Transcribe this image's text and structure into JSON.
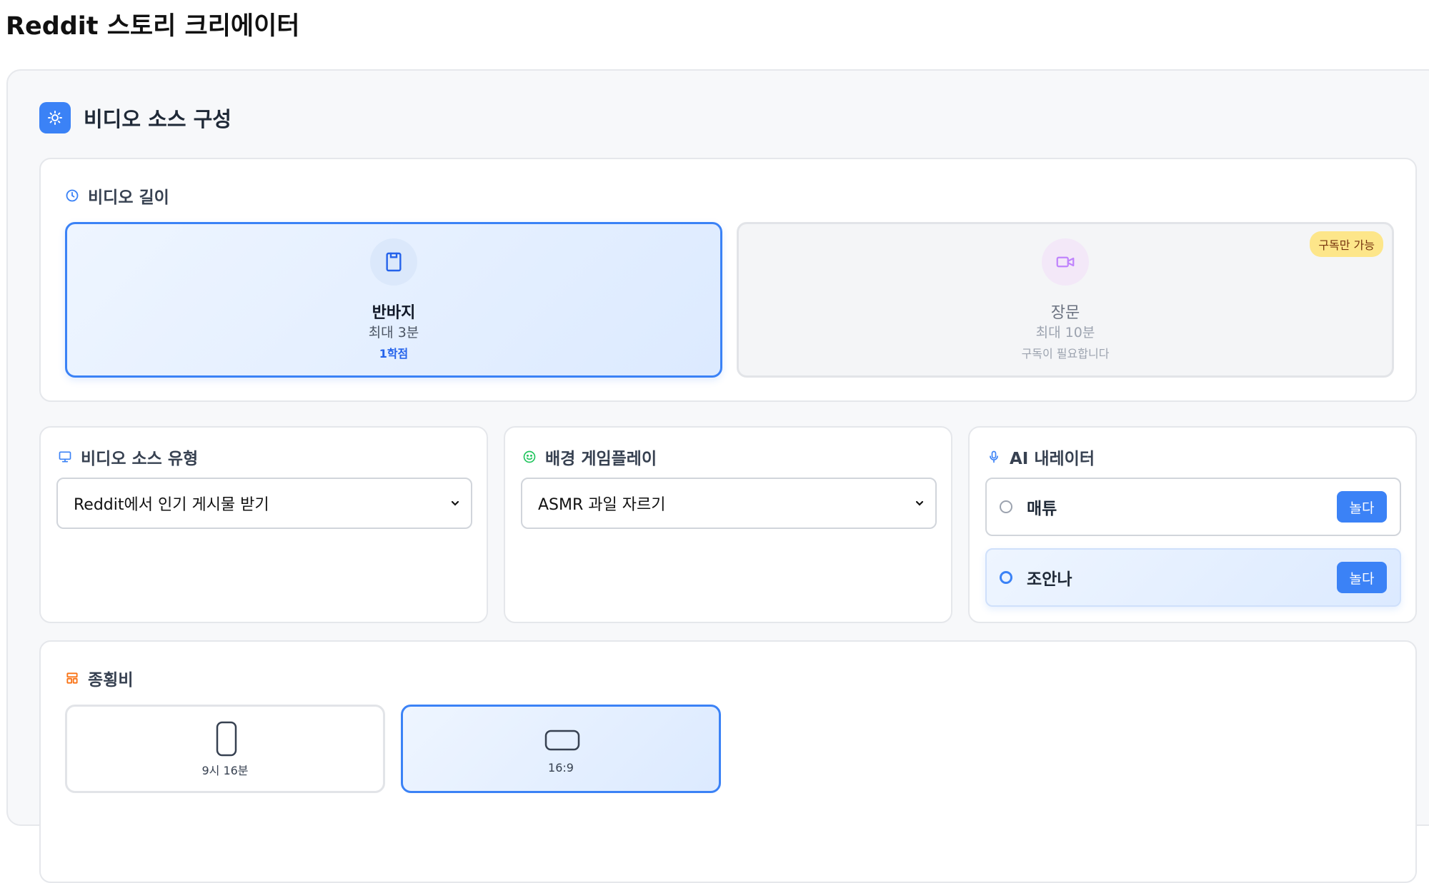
{
  "page": {
    "title": "Reddit 스토리 크리에이터"
  },
  "panel": {
    "title": "비디오 소스 구성",
    "icon": "lightbulb-icon"
  },
  "video_length": {
    "label": "비디오 길이",
    "icon": "clock-icon",
    "options": [
      {
        "name": "반바지",
        "max": "최대 3분",
        "note": "1학점",
        "icon": "book-icon",
        "selected": true
      },
      {
        "name": "장문",
        "max": "최대 10분",
        "note": "구독이 필요합니다",
        "badge": "구독만 가능",
        "icon": "video-camera-icon",
        "locked": true
      }
    ]
  },
  "video_source": {
    "label": "비디오 소스 유형",
    "icon": "monitor-icon",
    "selected": "Reddit에서 인기 게시물 받기"
  },
  "background_gameplay": {
    "label": "배경 게임플레이",
    "icon": "smiley-icon",
    "selected": "ASMR 과일 자르기"
  },
  "ai_narrator": {
    "label": "AI 내레이터",
    "icon": "microphone-icon",
    "play_label": "놀다",
    "voices": [
      {
        "name": "매튜",
        "selected": false
      },
      {
        "name": "조안나",
        "selected": true
      }
    ]
  },
  "aspect_ratio": {
    "label": "종횡비",
    "icon": "layout-icon",
    "options": [
      {
        "label": "9시 16분",
        "icon": "portrait-icon",
        "selected": false
      },
      {
        "label": "16:9",
        "icon": "landscape-icon",
        "selected": true
      }
    ]
  },
  "colors": {
    "accent": "#3b82f6",
    "badge": "#fde68a",
    "selected_bg": "#e4efff"
  }
}
